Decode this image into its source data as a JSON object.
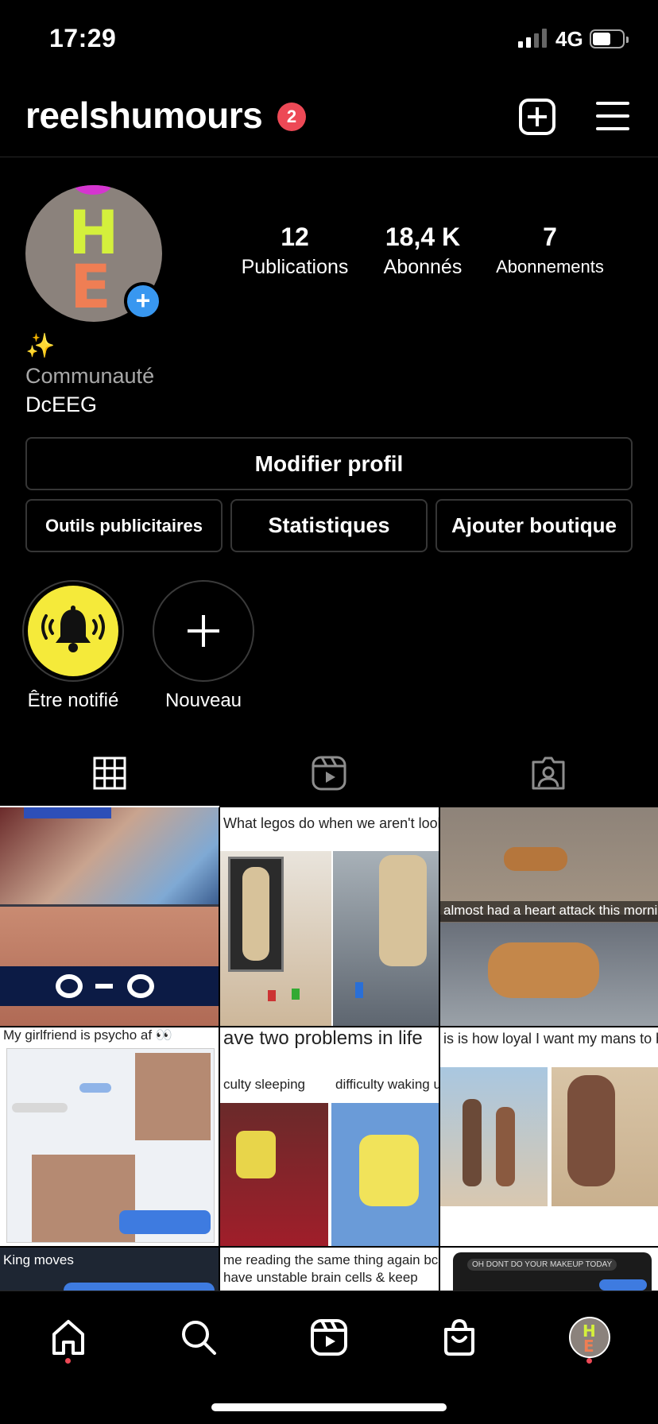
{
  "status_bar": {
    "time": "17:29",
    "network": "4G",
    "signal_bars_filled": 2,
    "signal_bars_total": 4,
    "battery_level": 0.5
  },
  "header": {
    "username": "reelshumours",
    "notification_count": "2",
    "icons": [
      "add-post-icon",
      "menu-icon"
    ]
  },
  "profile": {
    "avatar_letters": [
      "H",
      "E"
    ],
    "stats": [
      {
        "value": "12",
        "label": "Publications"
      },
      {
        "value": "18,4 K",
        "label": "Abonnés"
      },
      {
        "value": "7",
        "label": "Abonnements"
      }
    ],
    "emoji": "✨",
    "category": "Communauté",
    "bio": "DcEEG"
  },
  "buttons": {
    "edit_profile": "Modifier profil",
    "ad_tools": "Outils publicitaires",
    "insights": "Statistiques",
    "add_shop": "Ajouter boutique"
  },
  "highlights": [
    {
      "label": "Être notifié",
      "icon": "bell-ringing-icon"
    },
    {
      "label": "Nouveau",
      "icon": "plus-icon"
    }
  ],
  "tabs": [
    "grid-icon",
    "reels-icon",
    "tagged-icon"
  ],
  "posts": [
    {
      "caption": ""
    },
    {
      "caption": "What legos do when we aren't lookin"
    },
    {
      "caption": "almost had a heart attack this morning"
    },
    {
      "caption": "My girlfriend is psycho af 👀"
    },
    {
      "caption": "ave two problems in life",
      "sub_left": "culty sleeping",
      "sub_right": "difficulty waking u"
    },
    {
      "caption": "is is how loyal I want my mans to be"
    },
    {
      "caption": "King moves"
    },
    {
      "caption": "me reading the same thing again bcs i",
      "caption2": "have unstable brain cells & keep"
    },
    {
      "caption": "OH DONT DO YOUR MAKEUP TODAY"
    }
  ],
  "nav": [
    "home-icon",
    "search-icon",
    "reels-icon",
    "shop-icon",
    "profile-avatar"
  ],
  "colors": {
    "background": "#000000",
    "badge": "#ed4956",
    "accent_blue": "#3897f0",
    "highlight_yellow": "#f5ea3a"
  }
}
